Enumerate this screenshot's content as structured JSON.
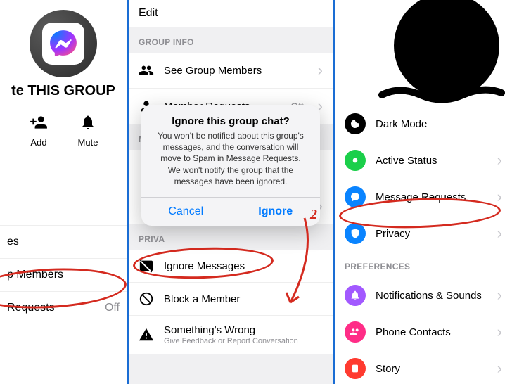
{
  "left": {
    "title": "te THIS GROUP",
    "actions": {
      "add": "Add",
      "mute": "Mute"
    },
    "items": [
      "es",
      "p Members",
      "Requests"
    ],
    "requests_val": "Off"
  },
  "mid": {
    "edit": "Edit",
    "sections": {
      "group_info": "GROUP INFO",
      "more": "MORE",
      "privacy": "PRIVA"
    },
    "rows": {
      "see_members": "See Group Members",
      "member_requests": "Member Requests",
      "member_requests_val": "Off",
      "ignore": "Ignore Messages",
      "block": "Block a Member",
      "wrong": "Something's Wrong",
      "wrong_sub": "Give Feedback or Report Conversation"
    },
    "dialog": {
      "title": "Ignore this group chat?",
      "body": "You won't be notified about this group's messages, and the conversation will move to Spam in Message Requests. We won't notify the group that the messages have been ignored.",
      "cancel": "Cancel",
      "ignore": "Ignore"
    },
    "annot": "2"
  },
  "right": {
    "rows": {
      "dark": "Dark Mode",
      "active": "Active Status",
      "requests": "Message Requests",
      "privacy": "Privacy",
      "prefs_label": "PREFERENCES",
      "notif": "Notifications & Sounds",
      "contacts": "Phone Contacts",
      "story": "Story"
    }
  }
}
